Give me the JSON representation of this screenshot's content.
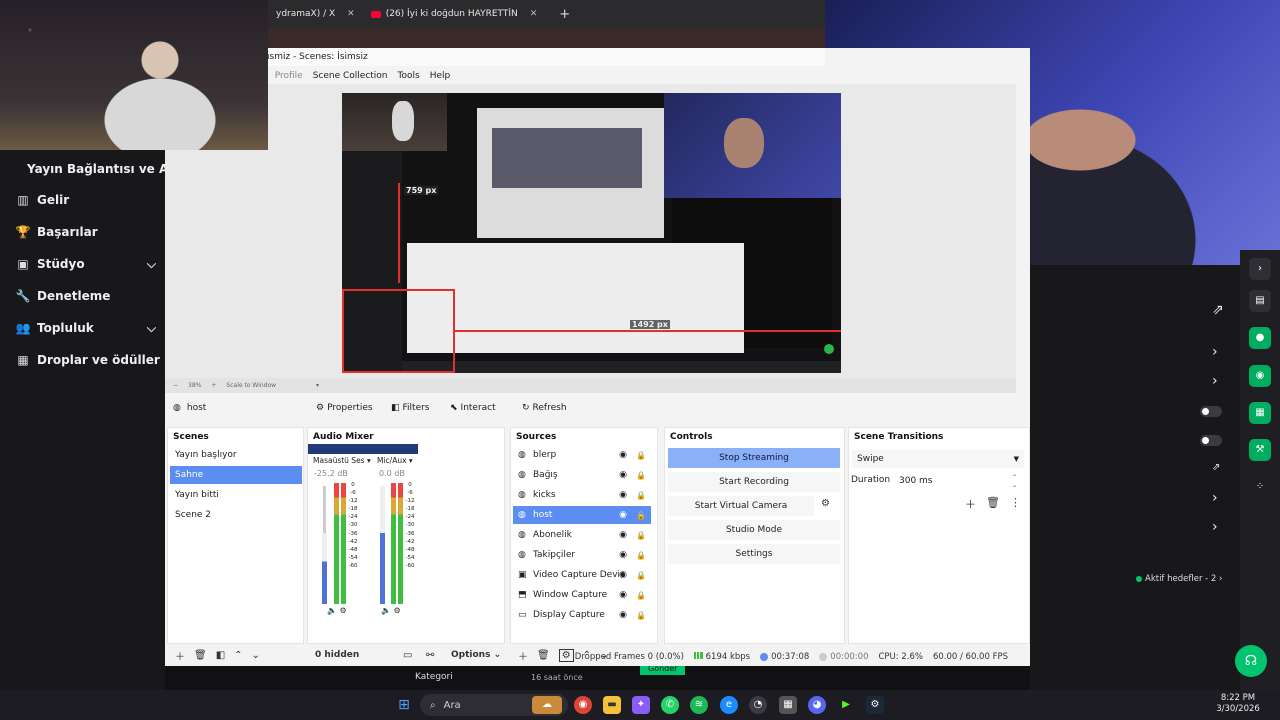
{
  "browser": {
    "tabs": [
      {
        "label": "ydramaX) / X"
      },
      {
        "label": "(26) İyi ki doğdun HAYRETTİN"
      }
    ],
    "new_tab": "+"
  },
  "dashboard": {
    "title": "Yayın Bağlantısı ve Anahtar",
    "items": [
      {
        "label": "Gelir",
        "icon": "chart-icon",
        "glyph": "▥"
      },
      {
        "label": "Başarılar",
        "icon": "trophy-icon",
        "glyph": "🏆"
      },
      {
        "label": "Stüdyo",
        "icon": "studio-icon",
        "glyph": "▣"
      },
      {
        "label": "Denetleme",
        "icon": "wrench-icon",
        "glyph": "🔧"
      },
      {
        "label": "Topluluk",
        "icon": "community-icon",
        "glyph": "👥"
      },
      {
        "label": "Droplar ve ödüller",
        "icon": "drops-icon",
        "glyph": "▦"
      }
    ]
  },
  "obs": {
    "title": "ısmiz - Scenes: İsimsiz",
    "menu": [
      "s",
      "Profile",
      "Scene Collection",
      "Tools",
      "Help"
    ],
    "preview_labels": {
      "height": "759 px",
      "width": "1492 px"
    },
    "zoom": {
      "percent": "38%",
      "mode": "Scale to Window"
    },
    "current_source": "host",
    "toolbar": {
      "properties": "Properties",
      "filters": "Filters",
      "interact": "Interact",
      "refresh": "Refresh"
    },
    "scenes": {
      "title": "Scenes",
      "items": [
        "Yayın başlıyor",
        "Sahne",
        "Yayın bitti",
        "Scene 2"
      ],
      "selected": "Sahne"
    },
    "mixer": {
      "title": "Audio Mixer",
      "channels": [
        {
          "name": "Masaüstü Ses",
          "db": "-25.2 dB"
        },
        {
          "name": "Mic/Aux",
          "db": "0.0 dB"
        }
      ],
      "ticks": [
        "0",
        "-6",
        "-12",
        "-18",
        "-24",
        "-30",
        "-36",
        "-42",
        "-48",
        "-54",
        "-60"
      ],
      "hidden_label": "0 hidden",
      "options_label": "Options"
    },
    "sources": {
      "title": "Sources",
      "items": [
        {
          "name": "blerp",
          "icon": "globe-icon",
          "locked": false
        },
        {
          "name": "Bağış",
          "icon": "globe-icon",
          "locked": false
        },
        {
          "name": "kicks",
          "icon": "globe-icon",
          "locked": false
        },
        {
          "name": "host",
          "icon": "globe-icon",
          "locked": false
        },
        {
          "name": "Abonelik",
          "icon": "globe-icon",
          "locked": false
        },
        {
          "name": "Takipçiler",
          "icon": "globe-icon",
          "locked": false
        },
        {
          "name": "Video Capture Devic",
          "icon": "camera-icon",
          "locked": false
        },
        {
          "name": "Window Capture",
          "icon": "window-icon",
          "locked": false
        },
        {
          "name": "Display Capture",
          "icon": "monitor-icon",
          "locked": true
        }
      ],
      "selected": "host"
    },
    "controls": {
      "title": "Controls",
      "buttons": [
        "Stop Streaming",
        "Start Recording",
        "Start Virtual Camera",
        "Studio Mode",
        "Settings"
      ]
    },
    "transitions": {
      "title": "Scene Transitions",
      "selected": "Swipe",
      "duration_label": "Duration",
      "duration_value": "300 ms"
    },
    "status": {
      "dropped": "Dropped Frames 0 (0.0%)",
      "bitrate": "6194 kbps",
      "stream_time": "00:37:08",
      "record_time": "00:00:00",
      "cpu": "CPU: 2.6%",
      "fps": "60.00 / 60.00 FPS"
    }
  },
  "right_panel": {
    "aktif": "Aktif hedefler - 2"
  },
  "bottom_strip": {
    "kategori": "Kategori",
    "time_ago": "16 saat önce",
    "gonder": "Gönder"
  },
  "taskbar": {
    "search_placeholder": "Ara",
    "time": "8:22 PM",
    "date": "3/30/2026"
  },
  "colors": {
    "accent": "#5b8ef0",
    "stream_button": "#8ab0f7",
    "twitch_green": "#00c46e",
    "guide_red": "#e03030"
  }
}
